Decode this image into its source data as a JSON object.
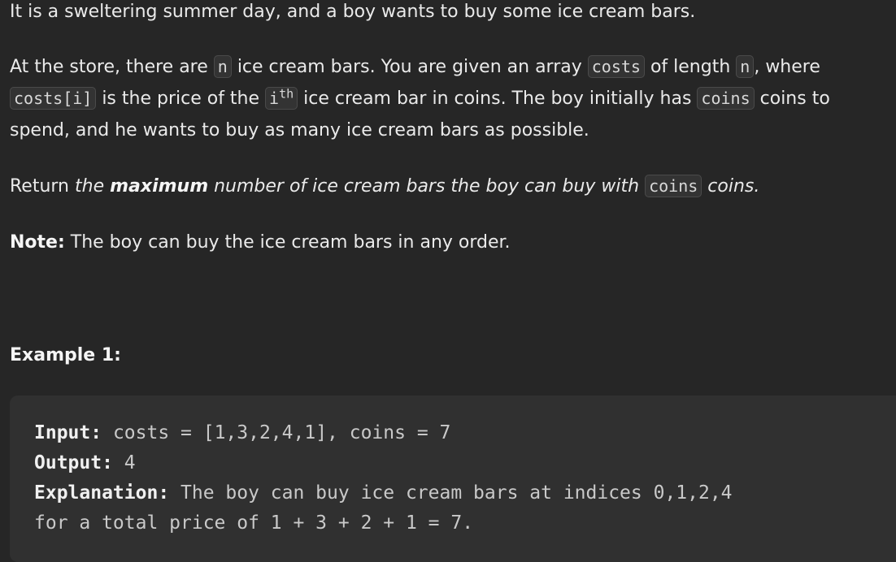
{
  "problem": {
    "intro": "It is a sweltering summer day, and a boy wants to buy some ice cream bars.",
    "para2": {
      "t1": "At the store, there are ",
      "c1": "n",
      "t2": " ice cream bars. You are given an array ",
      "c2": "costs",
      "t3": " of length ",
      "c3": "n",
      "t4": ", where ",
      "c4": "costs[i]",
      "t5": " is the price of the ",
      "c5": "i",
      "sup": "th",
      "t6": " ice cream bar in coins. The boy initially has ",
      "c6": "coins",
      "t7": " coins to spend, and he wants to buy as many ice cream bars as possible."
    },
    "para3": {
      "t1": "Return ",
      "e1": "the ",
      "strong": "maximum",
      "e2": " number of ice cream bars the boy can buy with ",
      "c1": "coins",
      "e3": " coins."
    },
    "note": {
      "label": "Note:",
      "text": " The boy can buy the ice cream bars in any order."
    },
    "example_heading": "Example 1:",
    "example": {
      "input_label": "Input:",
      "input_value": " costs = [1,3,2,4,1], coins = 7",
      "output_label": "Output:",
      "output_value": " 4",
      "explanation_label": "Explanation:",
      "explanation_line1": " The boy can buy ice cream bars at indices 0,1,2,4",
      "explanation_line2": "for a total price of 1 + 3 + 2 + 1 = 7."
    }
  }
}
